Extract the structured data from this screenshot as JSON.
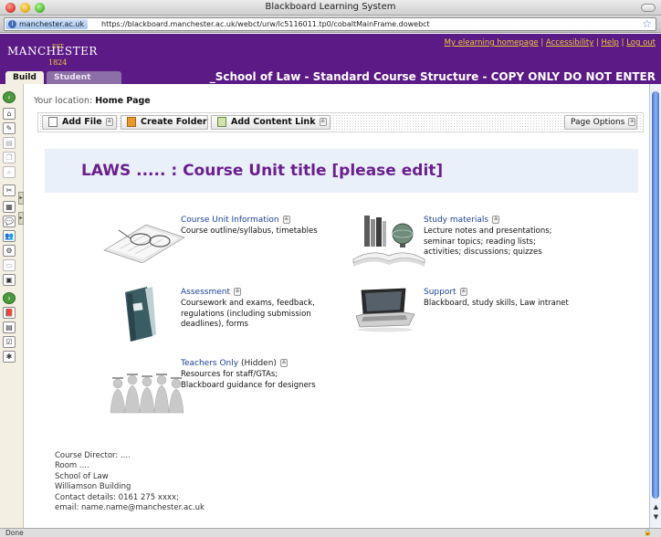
{
  "window": {
    "title": "Blackboard Learning System"
  },
  "address": {
    "site": "manchester.ac.uk",
    "url": "https://blackboard.manchester.ac.uk/webct/urw/lc5116011.tp0/cobaltMainFrame.dowebct"
  },
  "header": {
    "logo": "MANCHESTER",
    "logo_est": "EST",
    "logo_year": "1824",
    "links": [
      "My elearning homepage",
      "Accessibility",
      "Help",
      "Log out"
    ],
    "separator": "|",
    "tabs": [
      "Build",
      "Student View"
    ],
    "course_title": "_School of Law - Standard Course Structure - COPY ONLY DO NOT ENTER"
  },
  "location": {
    "label": "Your location:",
    "value": "Home Page"
  },
  "actions": {
    "add_file": "Add File",
    "create_folder": "Create Folder",
    "add_content_link": "Add Content Link",
    "page_options": "Page Options"
  },
  "banner": {
    "title": "LAWS ..... : Course Unit title [please edit]"
  },
  "items": [
    {
      "title": "Course Unit Information",
      "desc": "Course outline/syllabus, timetables",
      "thumb": "glasses-on-paper"
    },
    {
      "title": "Study materials",
      "desc": "Lecture notes and presentations;\nseminar topics; reading lists;\nactivities; discussions; quizzes",
      "thumb": "books-and-globe"
    },
    {
      "title": "Assessment",
      "desc": "Coursework and exams, feedback,\nregulations (including submission\ndeadlines), forms",
      "thumb": "binder"
    },
    {
      "title": "Support",
      "desc": "Blackboard, study skills, Law intranet",
      "thumb": "laptop"
    },
    {
      "title": "Teachers Only",
      "hidden": "(Hidden)",
      "desc": "Resources for staff/GTAs;\nBlackboard guidance for designers",
      "thumb": "graduates"
    }
  ],
  "footer": {
    "info": "Course Director: ....\nRoom ....\nSchool of Law\nWilliamson Building\nContact details: 0161 275 xxxx;\nemail: name.name@manchester.ac.uk"
  },
  "status": {
    "text": "Done"
  },
  "colors": {
    "brand_purple": "#5b1a86",
    "brand_gold": "#f0c93a",
    "link_blue": "#1d3f9c",
    "banner_bg": "#e9f0fa"
  }
}
